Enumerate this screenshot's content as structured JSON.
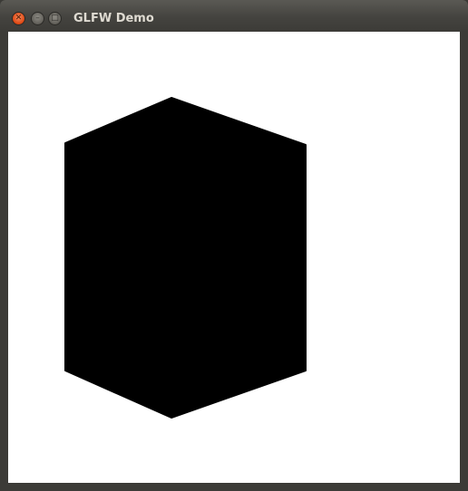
{
  "window": {
    "title": "GLFW Demo",
    "controls": {
      "close_icon": "close-icon",
      "minimize_icon": "minimize-icon",
      "maximize_icon": "maximize-icon"
    }
  },
  "colors": {
    "titlebar": "#3c3b37",
    "close_button": "#df4a16",
    "title_text": "#dfdbd2",
    "canvas_background": "#ffffff",
    "shape_fill": "#000000"
  },
  "canvas": {
    "shape": "hexagon"
  }
}
